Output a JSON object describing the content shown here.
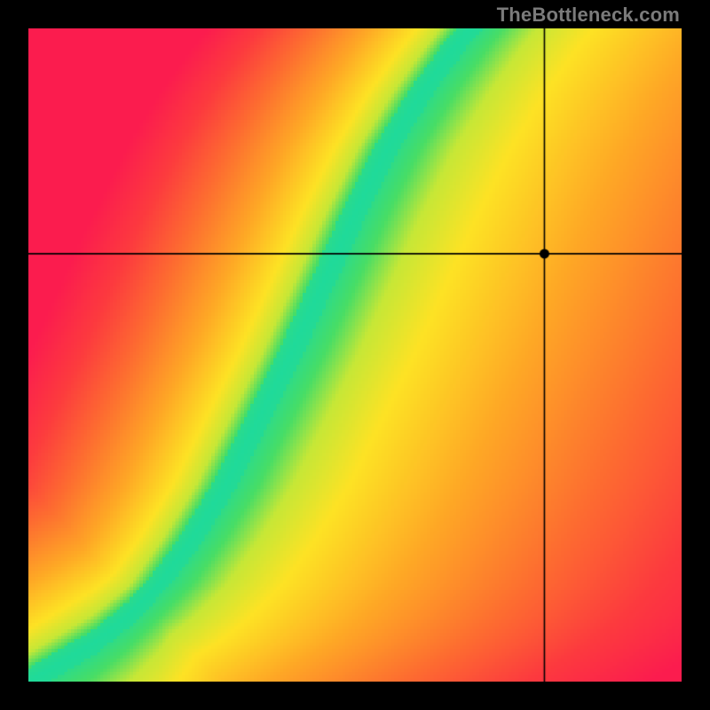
{
  "watermark": "TheBottleneck.com",
  "chart_data": {
    "type": "heatmap",
    "title": "",
    "xlabel": "",
    "ylabel": "",
    "xlim": [
      0,
      1
    ],
    "ylim": [
      0,
      1
    ],
    "grid": false,
    "legend": false,
    "crosshair": {
      "x": 0.79,
      "y": 0.655
    },
    "optimal_curve_x": [
      0.0,
      0.05,
      0.1,
      0.15,
      0.2,
      0.25,
      0.3,
      0.35,
      0.4,
      0.45,
      0.5,
      0.55,
      0.6,
      0.65,
      0.675
    ],
    "optimal_curve_y": [
      0.0,
      0.03,
      0.06,
      0.1,
      0.15,
      0.22,
      0.3,
      0.4,
      0.5,
      0.61,
      0.72,
      0.82,
      0.9,
      0.97,
      1.0
    ],
    "colorscale_note": "green along optimal curve → yellow → orange → red with distance",
    "grid_size": 200
  }
}
